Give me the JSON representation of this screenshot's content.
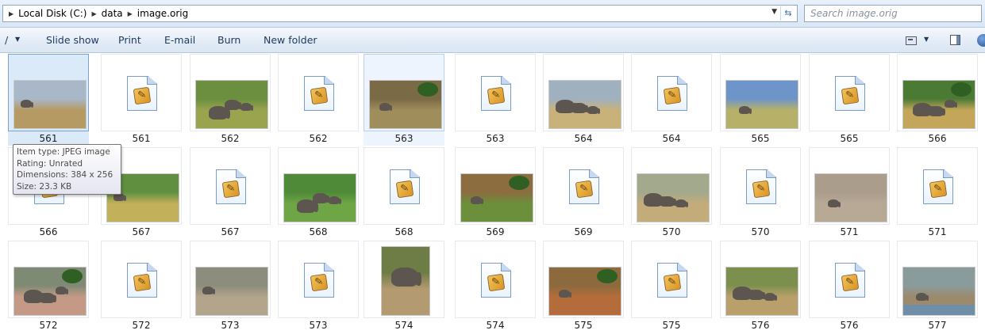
{
  "address_bar": {
    "crumbs": [
      "Local Disk (C:)",
      "data",
      "image.orig"
    ],
    "search_placeholder": "Search image.orig"
  },
  "toolbar": {
    "slideshow_label": "Slide show",
    "print_label": "Print",
    "email_label": "E-mail",
    "burn_label": "Burn",
    "new_folder_label": "New folder"
  },
  "tooltip": {
    "type_line": "Item type: JPEG image",
    "rating_line": "Rating: Unrated",
    "dimensions_line": "Dimensions: 384 x 256",
    "size_line": "Size: 23.3 KB"
  },
  "files": [
    {
      "name": "561",
      "kind": "photo",
      "state": "selected"
    },
    {
      "name": "561",
      "kind": "file"
    },
    {
      "name": "562",
      "kind": "photo"
    },
    {
      "name": "562",
      "kind": "file"
    },
    {
      "name": "563",
      "kind": "photo",
      "state": "hovered"
    },
    {
      "name": "563",
      "kind": "file"
    },
    {
      "name": "564",
      "kind": "photo"
    },
    {
      "name": "564",
      "kind": "file"
    },
    {
      "name": "565",
      "kind": "photo"
    },
    {
      "name": "565",
      "kind": "file"
    },
    {
      "name": "566",
      "kind": "photo"
    },
    {
      "name": "566",
      "kind": "file"
    },
    {
      "name": "567",
      "kind": "photo"
    },
    {
      "name": "567",
      "kind": "file"
    },
    {
      "name": "568",
      "kind": "photo"
    },
    {
      "name": "568",
      "kind": "file"
    },
    {
      "name": "569",
      "kind": "photo"
    },
    {
      "name": "569",
      "kind": "file"
    },
    {
      "name": "570",
      "kind": "photo"
    },
    {
      "name": "570",
      "kind": "file"
    },
    {
      "name": "571",
      "kind": "photo"
    },
    {
      "name": "571",
      "kind": "file"
    },
    {
      "name": "572",
      "kind": "photo"
    },
    {
      "name": "572",
      "kind": "file"
    },
    {
      "name": "573",
      "kind": "photo"
    },
    {
      "name": "573",
      "kind": "file"
    },
    {
      "name": "574",
      "kind": "photo"
    },
    {
      "name": "574",
      "kind": "file"
    },
    {
      "name": "575",
      "kind": "photo"
    },
    {
      "name": "575",
      "kind": "file"
    },
    {
      "name": "576",
      "kind": "photo"
    },
    {
      "name": "576",
      "kind": "file"
    },
    {
      "name": "577",
      "kind": "photo"
    }
  ]
}
